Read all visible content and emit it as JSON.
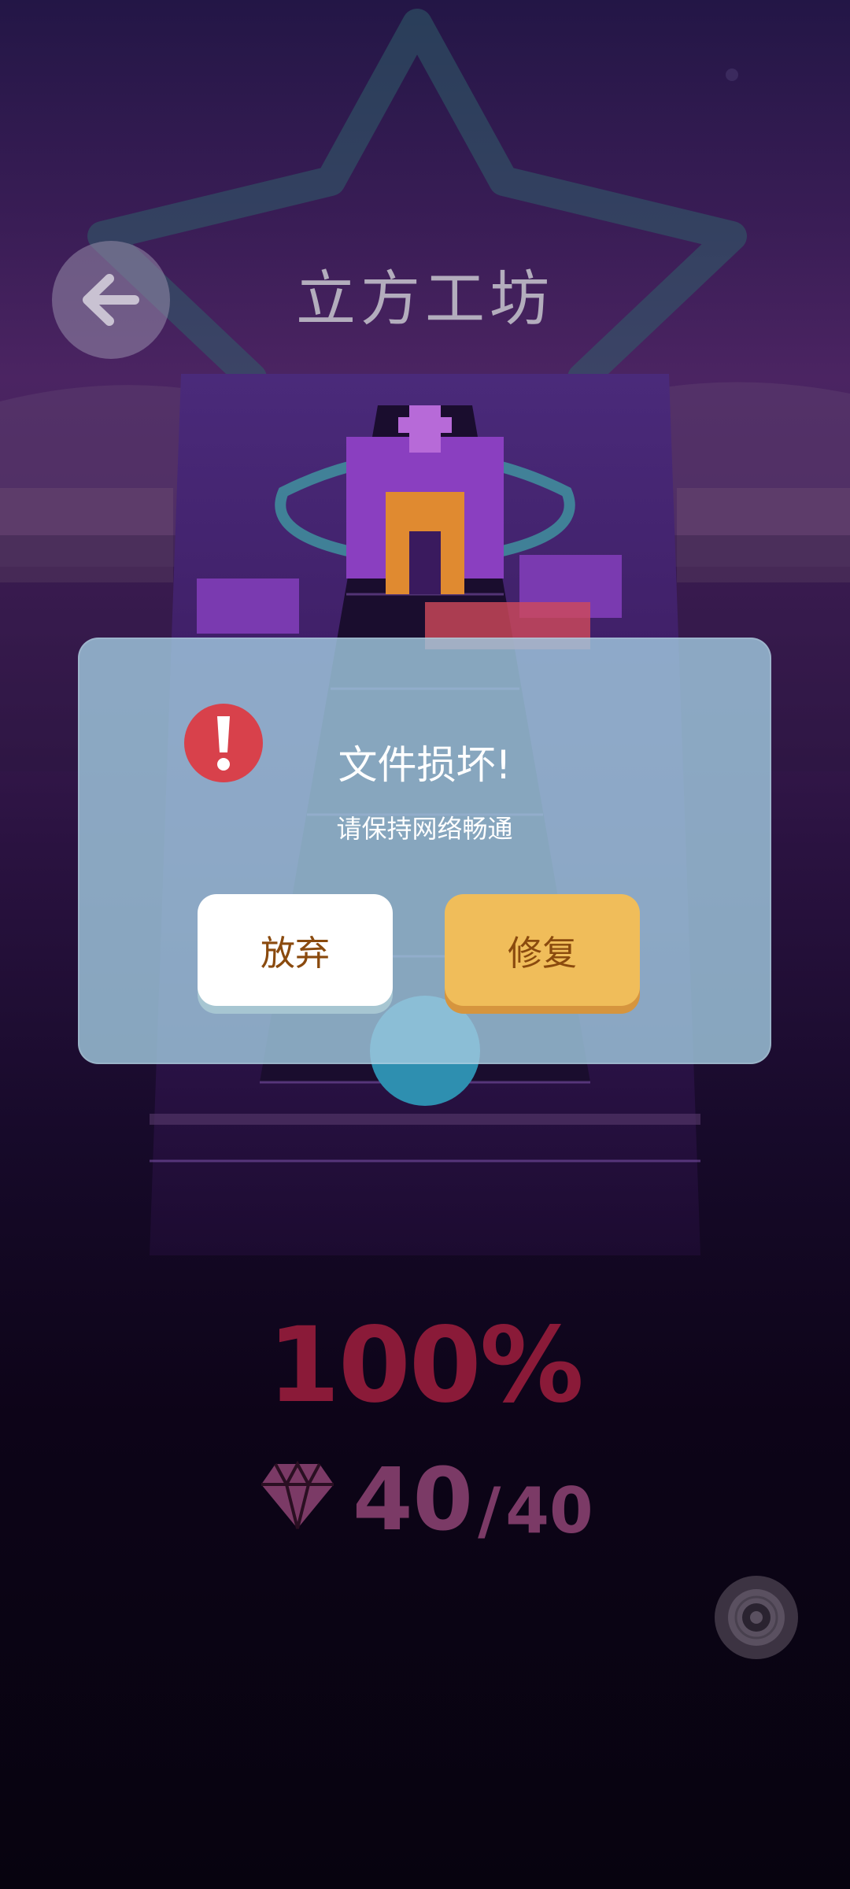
{
  "header": {
    "title": "立方工坊",
    "back_icon": "arrow-left-icon"
  },
  "result": {
    "percent": "100%",
    "gems_collected": "40",
    "gems_separator": "/",
    "gems_total": "40",
    "gem_icon": "diamond-icon"
  },
  "disc_icon": "disc-icon",
  "dialog": {
    "title": "文件损坏!",
    "message": "请保持网络畅通",
    "alert_icon": "exclamation-icon",
    "abandon_label": "放弃",
    "repair_label": "修复"
  },
  "colors": {
    "dialog_bg": "#a0c8de",
    "repair_button": "#f0bd5a",
    "abandon_button": "#ffffff",
    "button_text": "#8a4a0e",
    "percent_text": "#8a1a38",
    "alert_red": "#d8414b"
  }
}
